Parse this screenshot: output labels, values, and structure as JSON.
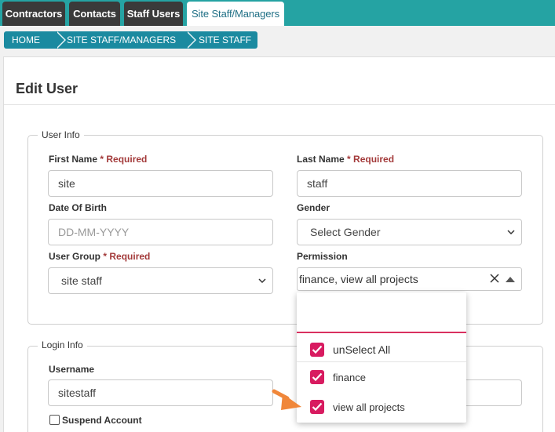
{
  "tabs": [
    {
      "label": "Contractors",
      "active": false
    },
    {
      "label": "Contacts",
      "active": false
    },
    {
      "label": "Staff Users",
      "active": false
    },
    {
      "label": "Site Staff/Managers",
      "active": true
    }
  ],
  "breadcrumb": [
    "HOME",
    "SITE STAFF/MANAGERS",
    "SITE STAFF"
  ],
  "page_title": "Edit User",
  "user_info": {
    "legend": "User Info",
    "first_name": {
      "label": "First Name",
      "required": "* Required",
      "value": "site"
    },
    "last_name": {
      "label": "Last Name",
      "required": "* Required",
      "value": "staff"
    },
    "dob": {
      "label": "Date Of Birth",
      "placeholder": "DD-MM-YYYY"
    },
    "gender": {
      "label": "Gender",
      "value": "Select Gender"
    },
    "user_group": {
      "label": "User Group",
      "required": "* Required",
      "value": "site staff"
    },
    "permission": {
      "label": "Permission",
      "value": "finance, view all projects"
    }
  },
  "permission_dropdown": {
    "search_value": "",
    "options": [
      {
        "label": "unSelect All",
        "checked": true
      },
      {
        "label": "finance",
        "checked": true
      },
      {
        "label": "view all projects",
        "checked": true
      }
    ]
  },
  "login_info": {
    "legend": "Login Info",
    "username": {
      "label": "Username",
      "value": "sitestaff"
    },
    "suspend": {
      "label": "Suspend Account",
      "checked": false
    }
  },
  "colors": {
    "tabbar": "#25a3a3",
    "breadcrumb": "#1b8aa0",
    "required": "#a33a3a",
    "checkbox_accent": "#d81b60",
    "annotation_arrow": "#f0873a"
  }
}
